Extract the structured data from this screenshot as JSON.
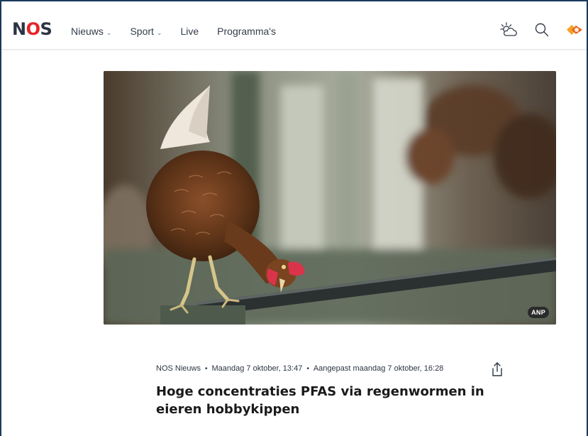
{
  "header": {
    "logo_prefix": "N",
    "logo_o": "O",
    "logo_suffix": "S",
    "nav": [
      {
        "label": "Nieuws",
        "has_dropdown": true
      },
      {
        "label": "Sport",
        "has_dropdown": true
      },
      {
        "label": "Live",
        "has_dropdown": false
      },
      {
        "label": "Programma's",
        "has_dropdown": false
      }
    ],
    "chevron": "⌄",
    "icons": [
      "weather-icon",
      "search-icon",
      "npo-logo-icon"
    ]
  },
  "hero": {
    "credit": "ANP"
  },
  "article": {
    "source": "NOS Nieuws",
    "separator": "•",
    "published": "Maandag 7 oktober, 13:47",
    "updated": "Aangepast maandag 7 oktober, 16:28",
    "title": "Hoge concentraties PFAS via regenwormen in eieren hobbykippen"
  },
  "colors": {
    "brand_red": "#e5252a",
    "logo_dark": "#2c3442",
    "frame_border": "#1b3a5e"
  }
}
